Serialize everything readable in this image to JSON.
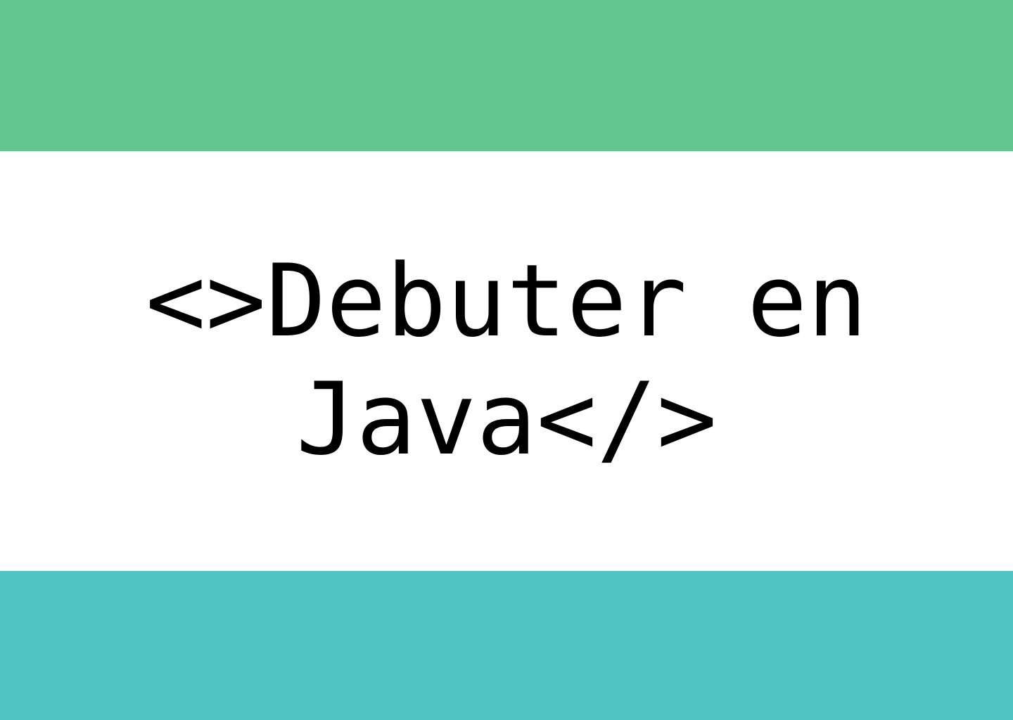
{
  "banner": {
    "title_lines": [
      "<>Debuter en",
      "Java</>"
    ]
  },
  "colors": {
    "top_band": "#62c78f",
    "middle_band": "#ffffff",
    "bottom_band": "#4fc4c3",
    "text": "#000000"
  }
}
